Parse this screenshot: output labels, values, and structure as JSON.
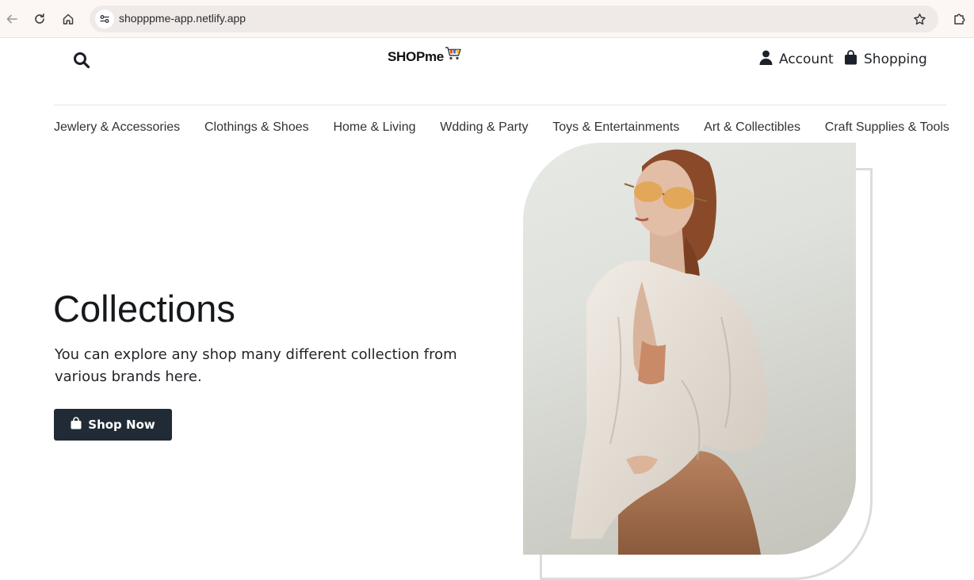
{
  "browser": {
    "url": "shopppme-app.netlify.app"
  },
  "header": {
    "logo_text": "SHOPme",
    "account_label": "Account",
    "shopping_label": "Shopping"
  },
  "categories": [
    "Jewlery & Accessories",
    "Clothings & Shoes",
    "Home & Living",
    "Wdding & Party",
    "Toys & Entertainments",
    "Art & Collectibles",
    "Craft Supplies & Tools"
  ],
  "hero": {
    "title": "Collections",
    "description": "You can explore any shop many different collection from various brands here.",
    "button_label": "Shop Now"
  },
  "colors": {
    "button_bg": "#212b36",
    "text_dark": "#212529"
  }
}
